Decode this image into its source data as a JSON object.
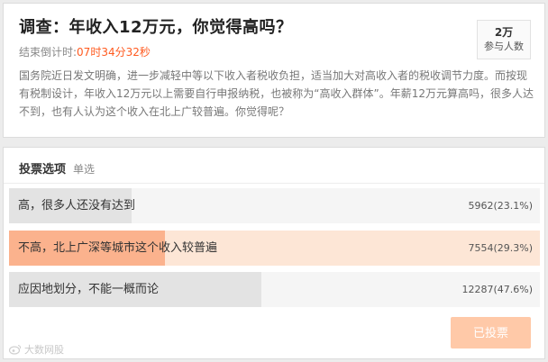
{
  "survey": {
    "title": "调查：年收入12万元，你觉得高吗？",
    "countdown_label": "结束倒计时:",
    "countdown_time": "07时34分32秒",
    "description": "国务院近日发文明确，进一步减轻中等以下收入者税收负担，适当加大对高收入者的税收调节力度。而按现有税制设计，年收入12万元以上需要自行申报纳税，也被称为“高收入群体”。年薪12万元算高吗，很多人达不到，也有人认为这个收入在北上广较普遍。你觉得呢？",
    "participants": {
      "count": "2万",
      "label": "参与人数"
    }
  },
  "vote": {
    "header": "投票选项",
    "type": "单选",
    "options": [
      {
        "label": "高，很多人还没有达到",
        "count": "5962(23.1%)",
        "fraction": 0.231,
        "fill_color": "#e3e3e3",
        "selected": false
      },
      {
        "label": "不高，北上广深等城市这个收入较普遍",
        "count": "7554(29.3%)",
        "fraction": 0.293,
        "fill_color": "#fbb28d",
        "selected": true
      },
      {
        "label": "应因地划分，不能一概而论",
        "count": "12287(47.6%)",
        "fraction": 0.476,
        "fill_color": "#e3e3e3",
        "selected": false
      }
    ],
    "voted_label": "已投票"
  },
  "colors": {
    "accent": "#ff5a1f",
    "button": "#ffc9a8"
  },
  "watermark": "大数网股"
}
